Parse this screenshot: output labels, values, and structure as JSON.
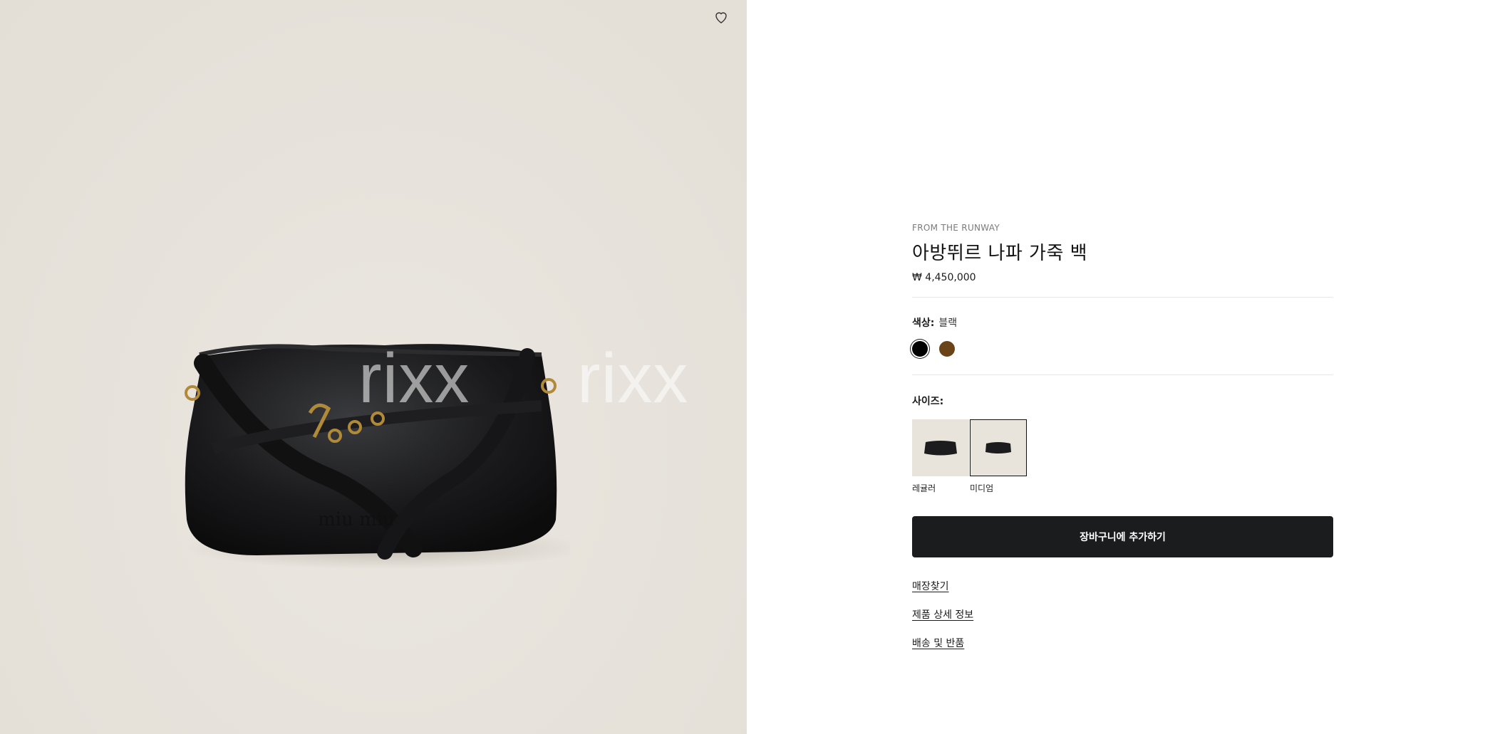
{
  "icons": {
    "wishlist": "heart-outline-icon"
  },
  "image": {
    "watermark": [
      "rixx",
      "rixx"
    ]
  },
  "product": {
    "eyebrow": "FROM THE RUNWAY",
    "title": "아방뛰르 나파 가죽 백",
    "price": "₩ 4,450,000"
  },
  "color": {
    "label": "색상:",
    "selected": "블랙",
    "swatches": [
      {
        "name": "black",
        "hex": "#000000",
        "selected": true
      },
      {
        "name": "brown",
        "hex": "#6b4318",
        "selected": false
      }
    ]
  },
  "size": {
    "label": "사이즈:",
    "options": [
      {
        "label": "레귤러",
        "selected": false
      },
      {
        "label": "미디엄",
        "selected": true
      }
    ]
  },
  "cart_button": "장바구니에 추가하기",
  "links": [
    "매장찾기",
    "제품 상세 정보",
    "배송 및 반품"
  ],
  "colors": {
    "button_bg": "#1b1c1e",
    "image_bg": "#e7e3dc"
  }
}
